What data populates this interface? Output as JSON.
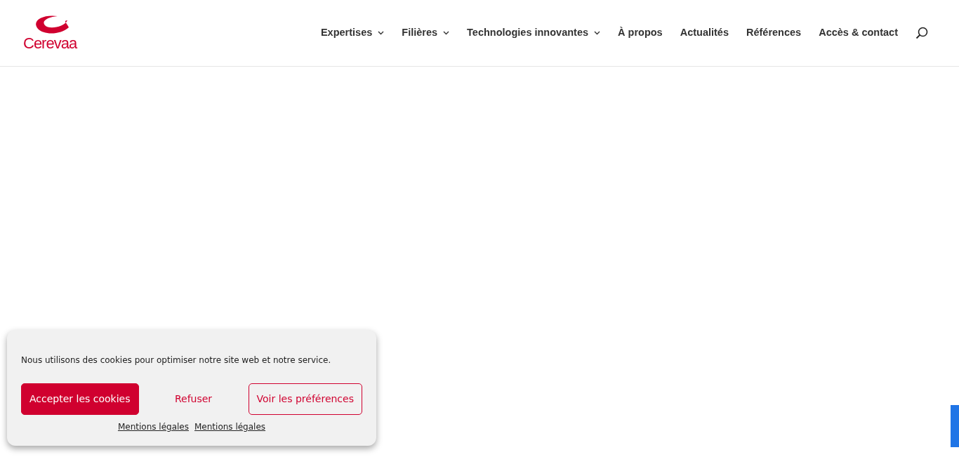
{
  "header": {
    "logo_text": "Cerevaa",
    "nav": [
      {
        "label": "Expertises",
        "has_menu": true
      },
      {
        "label": "Filières",
        "has_menu": true
      },
      {
        "label": "Technologies innovantes",
        "has_menu": true
      },
      {
        "label": "À propos",
        "has_menu": false
      },
      {
        "label": "Actualités",
        "has_menu": false
      },
      {
        "label": "Références",
        "has_menu": false
      },
      {
        "label": "Accès & contact",
        "has_menu": false
      }
    ]
  },
  "cookie_banner": {
    "message": "Nous utilisons des cookies pour optimiser notre site web et notre service.",
    "buttons": [
      {
        "label": "Accepter les cookies",
        "kind": "primary"
      },
      {
        "label": "Refuser",
        "kind": "text"
      },
      {
        "label": "Voir les préférences",
        "kind": "outline"
      }
    ],
    "links": [
      "Mentions légales",
      "Mentions légales"
    ]
  }
}
